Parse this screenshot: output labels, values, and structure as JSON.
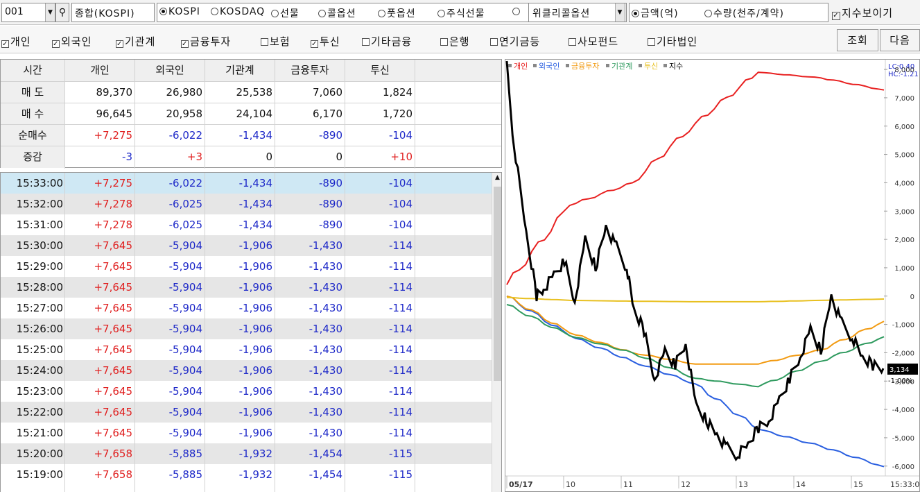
{
  "toolbar": {
    "code": "001",
    "name": "종합(KOSPI)",
    "markets": [
      "KOSPI",
      "KOSDAQ",
      "선물",
      "콜옵션",
      "풋옵션",
      "주식선물",
      "",
      "위클리콜옵션"
    ],
    "selected_market": "KOSPI",
    "units": [
      "금액(억)",
      "수량(천주/계약)"
    ],
    "selected_unit": "금액(억)",
    "show_index_label": "지수보이기",
    "show_index_checked": true
  },
  "filters": [
    {
      "label": "개인",
      "checked": true
    },
    {
      "label": "외국인",
      "checked": true
    },
    {
      "label": "기관계",
      "checked": true
    },
    {
      "label": "금융투자",
      "checked": true
    },
    {
      "label": "보험",
      "checked": false
    },
    {
      "label": "투신",
      "checked": true
    },
    {
      "label": "기타금융",
      "checked": false
    },
    {
      "label": "은행",
      "checked": false
    },
    {
      "label": "연기금등",
      "checked": false
    },
    {
      "label": "사모펀드",
      "checked": false
    },
    {
      "label": "기타법인",
      "checked": false
    }
  ],
  "buttons": {
    "query": "조회",
    "next": "다음"
  },
  "summary": {
    "headers": [
      "시간",
      "개인",
      "외국인",
      "기관계",
      "금융투자",
      "투신"
    ],
    "rows": [
      {
        "label": "매 도",
        "values": [
          "89,370",
          "26,980",
          "25,538",
          "7,060",
          "1,824"
        ]
      },
      {
        "label": "매 수",
        "values": [
          "96,645",
          "20,958",
          "24,104",
          "6,170",
          "1,720"
        ]
      },
      {
        "label": "순매수",
        "values": [
          "+7,275",
          "-6,022",
          "-1,434",
          "-890",
          "-104"
        ]
      },
      {
        "label": "증감",
        "values": [
          "-3",
          "+3",
          "0",
          "0",
          "+10"
        ]
      }
    ]
  },
  "timeseries": [
    {
      "time": "15:33:00",
      "values": [
        "+7,275",
        "-6,022",
        "-1,434",
        "-890",
        "-104"
      ]
    },
    {
      "time": "15:32:00",
      "values": [
        "+7,278",
        "-6,025",
        "-1,434",
        "-890",
        "-104"
      ]
    },
    {
      "time": "15:31:00",
      "values": [
        "+7,278",
        "-6,025",
        "-1,434",
        "-890",
        "-104"
      ]
    },
    {
      "time": "15:30:00",
      "values": [
        "+7,645",
        "-5,904",
        "-1,906",
        "-1,430",
        "-114"
      ]
    },
    {
      "time": "15:29:00",
      "values": [
        "+7,645",
        "-5,904",
        "-1,906",
        "-1,430",
        "-114"
      ]
    },
    {
      "time": "15:28:00",
      "values": [
        "+7,645",
        "-5,904",
        "-1,906",
        "-1,430",
        "-114"
      ]
    },
    {
      "time": "15:27:00",
      "values": [
        "+7,645",
        "-5,904",
        "-1,906",
        "-1,430",
        "-114"
      ]
    },
    {
      "time": "15:26:00",
      "values": [
        "+7,645",
        "-5,904",
        "-1,906",
        "-1,430",
        "-114"
      ]
    },
    {
      "time": "15:25:00",
      "values": [
        "+7,645",
        "-5,904",
        "-1,906",
        "-1,430",
        "-114"
      ]
    },
    {
      "time": "15:24:00",
      "values": [
        "+7,645",
        "-5,904",
        "-1,906",
        "-1,430",
        "-114"
      ]
    },
    {
      "time": "15:23:00",
      "values": [
        "+7,645",
        "-5,904",
        "-1,906",
        "-1,430",
        "-114"
      ]
    },
    {
      "time": "15:22:00",
      "values": [
        "+7,645",
        "-5,904",
        "-1,906",
        "-1,430",
        "-114"
      ]
    },
    {
      "time": "15:21:00",
      "values": [
        "+7,645",
        "-5,904",
        "-1,906",
        "-1,430",
        "-114"
      ]
    },
    {
      "time": "15:20:00",
      "values": [
        "+7,658",
        "-5,885",
        "-1,932",
        "-1,454",
        "-115"
      ]
    },
    {
      "time": "15:19:00",
      "values": [
        "+7,658",
        "-5,885",
        "-1,932",
        "-1,454",
        "-115"
      ]
    }
  ],
  "chart": {
    "legend": [
      {
        "name": "개인",
        "color": "#e82020"
      },
      {
        "name": "외국인",
        "color": "#2a5fe0"
      },
      {
        "name": "금융투자",
        "color": "#f29a10"
      },
      {
        "name": "기관계",
        "color": "#2e9a5e"
      },
      {
        "name": "투신",
        "color": "#e8c020"
      },
      {
        "name": "지수",
        "color": "#000000"
      }
    ],
    "corner_top": "LC:0.40",
    "corner_bottom": "HC:-1.21",
    "y_ticks": [
      "8,000",
      "7,000",
      "6,000",
      "5,000",
      "4,000",
      "3,000",
      "2,000",
      "1,000",
      "0",
      "-1,000",
      "-2,000",
      "-3,000",
      "-4,000",
      "-5,000",
      "-6,000"
    ],
    "x_ticks": [
      "05/17",
      "10",
      "11",
      "12",
      "13",
      "14",
      "15"
    ],
    "x_end_label": "15:33:0",
    "index_value": "3,134",
    "index_change": "-1.00%"
  },
  "chart_data": {
    "type": "line",
    "x": [
      "05/17",
      "10",
      "11",
      "12",
      "13",
      "14",
      "15"
    ],
    "ylim": [
      -6300,
      8100
    ],
    "series": [
      {
        "name": "개인",
        "values": [
          400,
          3200,
          4000,
          6100,
          7900,
          7700,
          7275
        ]
      },
      {
        "name": "외국인",
        "values": [
          0,
          -1400,
          -2300,
          -3100,
          -4700,
          -5300,
          -6022
        ]
      },
      {
        "name": "금융투자",
        "values": [
          0,
          -1300,
          -2000,
          -2400,
          -2400,
          -1900,
          -890
        ]
      },
      {
        "name": "기관계",
        "values": [
          -300,
          -1400,
          -2000,
          -2900,
          -3200,
          -2300,
          -1434
        ]
      },
      {
        "name": "투신",
        "values": [
          -50,
          -150,
          -180,
          -200,
          -200,
          -150,
          -104
        ]
      }
    ]
  }
}
